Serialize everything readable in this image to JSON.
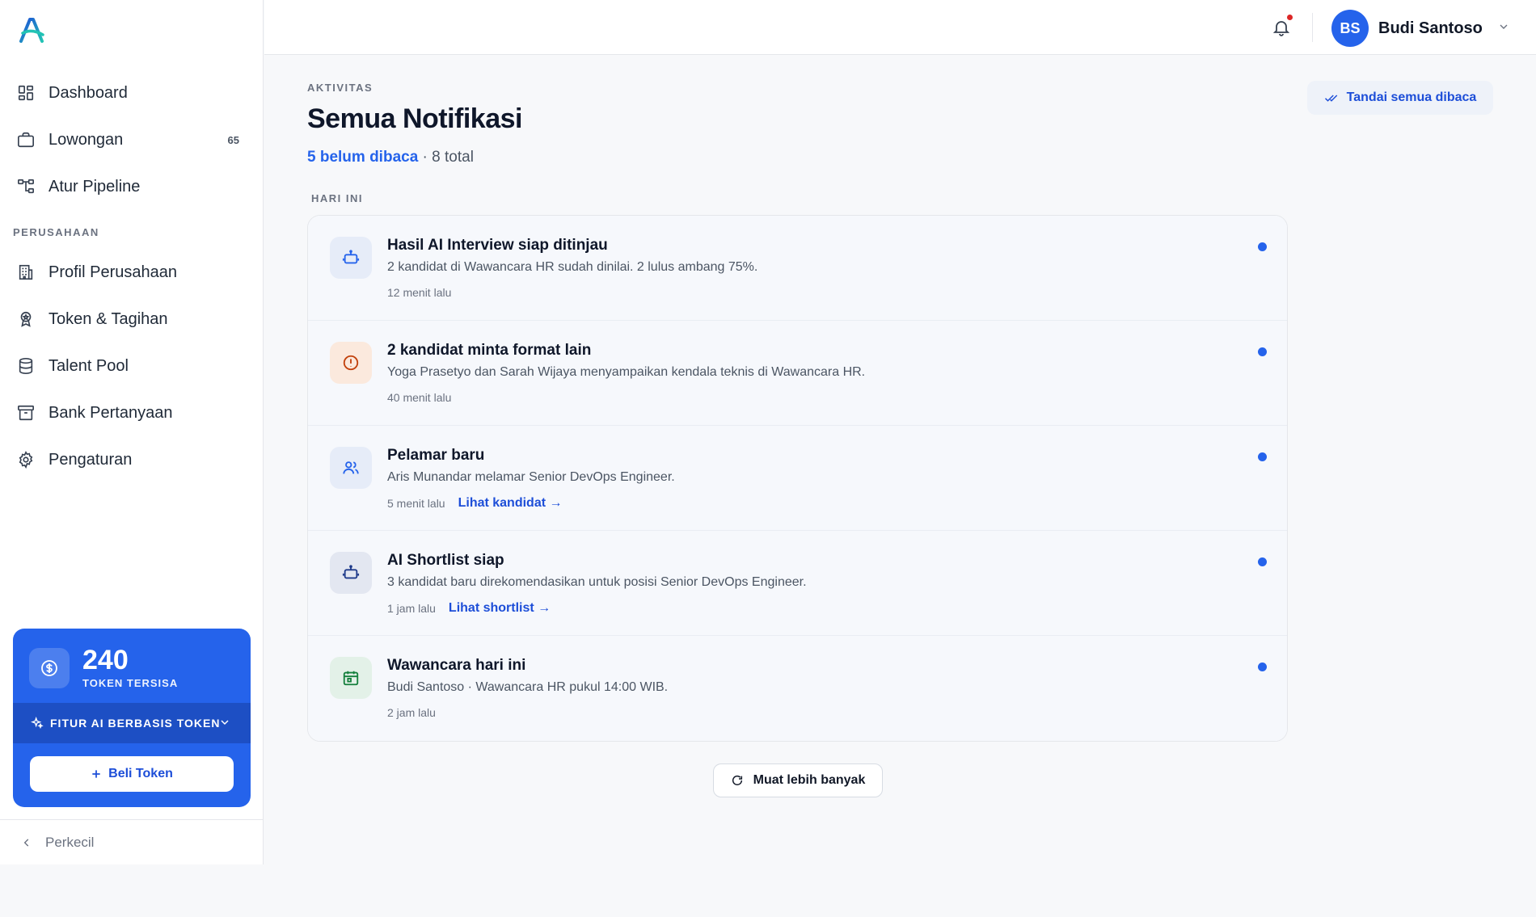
{
  "sidebar": {
    "items": [
      {
        "label": "Dashboard",
        "icon": "grid-icon"
      },
      {
        "label": "Lowongan",
        "icon": "briefcase-icon",
        "badge": "65"
      },
      {
        "label": "Atur Pipeline",
        "icon": "pipeline-icon"
      }
    ],
    "section_label": "PERUSAHAAN",
    "company_items": [
      {
        "label": "Profil Perusahaan",
        "icon": "building-icon"
      },
      {
        "label": "Token & Tagihan",
        "icon": "award-icon"
      },
      {
        "label": "Talent Pool",
        "icon": "database-icon"
      },
      {
        "label": "Bank Pertanyaan",
        "icon": "archive-icon"
      },
      {
        "label": "Pengaturan",
        "icon": "gear-icon"
      }
    ],
    "token": {
      "count": "240",
      "label": "TOKEN TERSISA",
      "features_label": "FITUR AI BERBASIS TOKEN",
      "buy_label": "Beli Token"
    },
    "collapse_label": "Perkecil"
  },
  "topbar": {
    "avatar_initials": "BS",
    "user_name": "Budi Santoso"
  },
  "main": {
    "eyebrow": "AKTIVITAS",
    "title": "Semua Notifikasi",
    "unread_text": "5 belum dibaca",
    "total_text": " · 8 total",
    "mark_all_label": "Tandai semua dibaca",
    "group_label": "HARI INI",
    "load_more_label": "Muat lebih banyak",
    "notifications": [
      {
        "title": "Hasil AI Interview siap ditinjau",
        "body": "2 kandidat di Wawancara HR sudah dinilai. 2 lulus ambang 75%.",
        "time": "12 menit lalu",
        "link": "",
        "icon": "robot-icon"
      },
      {
        "title": "2 kandidat minta format lain",
        "body": "Yoga Prasetyo dan Sarah Wijaya menyampaikan kendala teknis di Wawancara HR.",
        "time": "40 menit lalu",
        "link": "",
        "icon": "alert-circle-icon"
      },
      {
        "title": "Pelamar baru",
        "body": "Aris Munandar melamar Senior DevOps Engineer.",
        "time": "5 menit lalu",
        "link": "Lihat kandidat →",
        "icon": "users-icon"
      },
      {
        "title": "AI Shortlist siap",
        "body": "3 kandidat baru direkomendasikan untuk posisi Senior DevOps Engineer.",
        "time": "1 jam lalu",
        "link": "Lihat shortlist →",
        "icon": "robot-icon"
      },
      {
        "title": "Wawancara hari ini",
        "body": "Budi Santoso · Wawancara HR pukul 14:00 WIB.",
        "time": "2 jam lalu",
        "link": "",
        "icon": "calendar-icon"
      }
    ]
  },
  "colors": {
    "primary": "#2563eb",
    "alert": "#c2410c",
    "success": "#15803d",
    "notification_dot": "#dc2626"
  }
}
